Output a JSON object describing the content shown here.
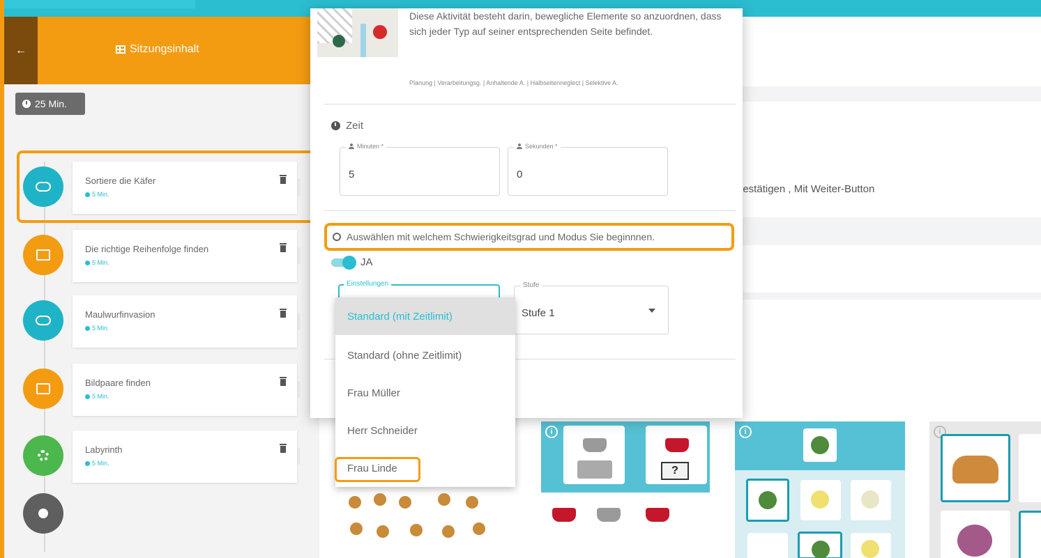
{
  "sidebar": {
    "back_glyph": "←",
    "title": "Sitzungsinhalt",
    "duration": "25 Min.",
    "activities": [
      {
        "title": "Sortiere die Käfer",
        "duration": "5 Min.",
        "color": "#1fb3c7",
        "icon": "gamepad-icon"
      },
      {
        "title": "Die richtige Reihenfolge finden",
        "duration": "5 Min.",
        "color": "#f39c12",
        "icon": "window-icon"
      },
      {
        "title": "Maulwurfinvasion",
        "duration": "5 Min.",
        "color": "#1fb3c7",
        "icon": "gamepad-icon"
      },
      {
        "title": "Bildpaare finden",
        "duration": "5 Min.",
        "color": "#f39c12",
        "icon": "window-icon"
      },
      {
        "title": "Labyrinth",
        "duration": "5 Min.",
        "color": "#4cb74c",
        "icon": "gears-icon"
      }
    ]
  },
  "modal": {
    "description": "Diese Aktivität besteht darin, bewegliche Elemente so anzuordnen, dass sich jeder Typ auf seiner entsprechenden Seite befindet.",
    "tags": "Planung | Verarbeitungsg. | Anhaltende A. | Halbseitenneglect | Selektive A.",
    "time_section": "Zeit",
    "minutes_label": "Minuten *",
    "minutes_value": "5",
    "seconds_label": "Sekunden *",
    "seconds_value": "0",
    "choose_text": "Auswählen mit welchem Schwierigkeitsgrad und Modus Sie beginnnen.",
    "toggle_label": "JA",
    "settings_label": "Einstellungen",
    "level_label": "Stufe",
    "level_value": "Stufe 1",
    "dropdown_options": [
      "Standard (mit Zeitlimit)",
      "Standard (ohne Zeitlimit)",
      "Frau Müller",
      "Herr Schneider",
      "Frau Linde"
    ]
  },
  "background": {
    "confirm_text": "bestätigen , Mit Weiter-Button",
    "side_button_glyph": "S",
    "info_glyph": "i",
    "question_glyph": "?"
  },
  "colors": {
    "accent_teal": "#2bbdd0",
    "accent_orange": "#f39c12"
  }
}
